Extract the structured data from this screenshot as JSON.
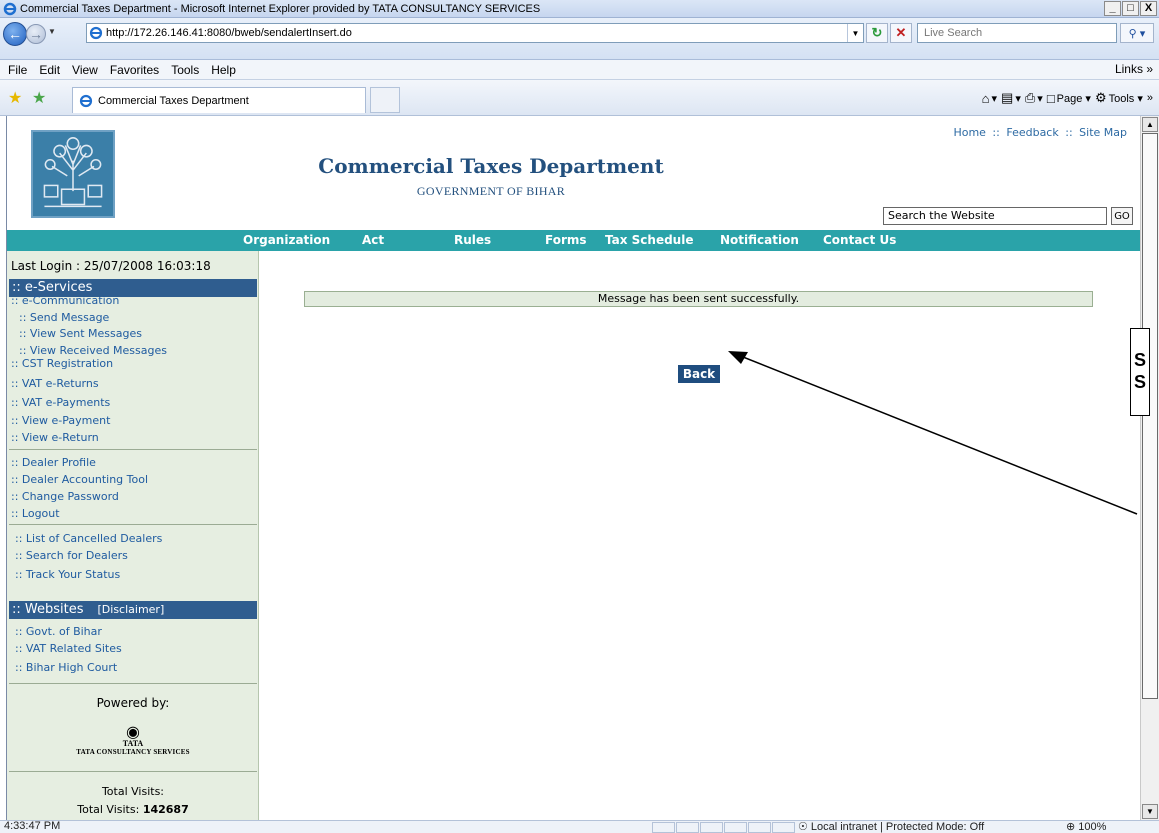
{
  "window": {
    "title": "Commercial Taxes Department - Microsoft Internet Explorer provided by TATA CONSULTANCY SERVICES",
    "controls": [
      "_",
      "□",
      "X"
    ]
  },
  "address_bar": {
    "url": "http://172.26.146.41:8080/bweb/sendalertInsert.do",
    "live_search_placeholder": "Live Search"
  },
  "menu": {
    "items": [
      "File",
      "Edit",
      "View",
      "Favorites",
      "Tools",
      "Help"
    ],
    "links": "Links »"
  },
  "favorites_bar": {
    "tab_title": "Commercial Taxes Department",
    "commands": [
      "Page ▾",
      "Tools ▾"
    ]
  },
  "header": {
    "title": "Commercial Taxes Department",
    "subtitle": "GOVERNMENT OF BIHAR",
    "top_links": [
      "Home",
      "Feedback",
      "Site Map"
    ],
    "top_links_sep": "::",
    "search_placeholder": "Search the Website",
    "go_label": "GO"
  },
  "topnav": [
    "Organization",
    "Act",
    "Rules",
    "Forms",
    "Tax Schedule",
    "Notification",
    "Contact Us"
  ],
  "sidebar": {
    "last_login": "Last Login : 25/07/2008 16:03:18",
    "eservices_title": ":: e-Services",
    "ecomm": ":: e-Communication",
    "ecomm_sub": [
      ":: Send Message",
      ":: View Sent Messages",
      ":: View Received Messages"
    ],
    "eservice_links": [
      ":: CST Registration",
      ":: VAT e-Returns",
      ":: VAT e-Payments",
      ":: View e-Payment",
      ":: View e-Return"
    ],
    "account_links": [
      ":: Dealer Profile",
      ":: Dealer Accounting Tool",
      ":: Change Password",
      ":: Logout"
    ],
    "dealer_links": [
      ":: List of Cancelled Dealers",
      ":: Search for Dealers",
      ":: Track Your Status"
    ],
    "websites_title": ":: Websites",
    "disclaimer": "[Disclaimer]",
    "website_links": [
      ":: Govt. of Bihar",
      ":: VAT Related Sites",
      ":: Bihar High Court"
    ],
    "powered_by": "Powered by:",
    "tata_mark": "TATA",
    "tata_company": "TATA CONSULTANCY SERVICES",
    "total_visits_label": "Total Visits:",
    "total_visits_line": "Total Visits:",
    "total_visits_value": "142687"
  },
  "main": {
    "message": "Message has been sent successfully.",
    "back_label": "Back"
  },
  "annotation": {
    "letters": [
      "S",
      "S"
    ]
  },
  "status_bar": {
    "time": "4:33:47 PM",
    "zone": "Local intranet | Protected Mode: Off",
    "zoom": "⊕ 100%"
  }
}
